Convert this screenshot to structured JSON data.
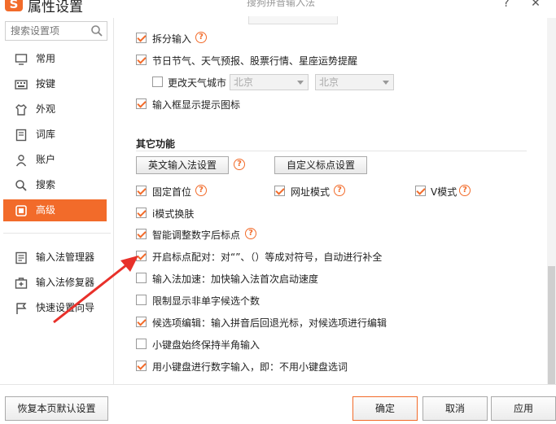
{
  "window": {
    "title": "属性设置",
    "subtitle": "搜狗拼音输入法",
    "help_glyph": "?",
    "close_glyph": "✕"
  },
  "sidebar": {
    "search_placeholder": "搜索设置项",
    "items": [
      {
        "label": "常用",
        "icon": "monitor-icon"
      },
      {
        "label": "按键",
        "icon": "keyboard-icon"
      },
      {
        "label": "外观",
        "icon": "shirt-icon"
      },
      {
        "label": "词库",
        "icon": "dictionary-icon"
      },
      {
        "label": "账户",
        "icon": "user-icon"
      },
      {
        "label": "搜索",
        "icon": "search-icon"
      },
      {
        "label": "高级",
        "icon": "advanced-icon",
        "active": true
      }
    ],
    "tools": [
      {
        "label": "输入法管理器",
        "icon": "manager-icon"
      },
      {
        "label": "输入法修复器",
        "icon": "repair-icon"
      },
      {
        "label": "快速设置向导",
        "icon": "wizard-flag-icon"
      }
    ]
  },
  "content": {
    "split_input": "拆分输入",
    "festival_info": "节日节气、天气预报、股票行情、星座运势提醒",
    "change_city": "更改天气城市",
    "city_select_1": "北京",
    "city_select_2": "北京",
    "show_tip_icon": "输入框显示提示图标",
    "other_section": "其它功能",
    "english_settings_btn": "英文输入法设置",
    "custom_punct_btn": "自定义标点设置",
    "fixed_first": "固定首位",
    "url_mode": "网址模式",
    "v_mode": "V模式",
    "i_mode": "i模式换肤",
    "smart_punct": "智能调整数字后标点",
    "auto_pair": "开启标点配对：对“”、（）等成对符号，自动进行补全",
    "speed_up": "输入法加速：加快输入法首次启动速度",
    "limit_non_single": "限制显示非单字候选个数",
    "candidate_edit": "候选项编辑：输入拼音后回退光标，对候选项进行编辑",
    "halfwidth_small_kb": "小键盘始终保持半角输入",
    "numpad_digits": "用小键盘进行数字输入，即：不用小键盘选词",
    "help_glyph": "?"
  },
  "checks": {
    "split_input": true,
    "festival_info": true,
    "change_city": false,
    "show_tip_icon": true,
    "fixed_first": true,
    "url_mode": true,
    "v_mode": true,
    "i_mode": true,
    "smart_punct": true,
    "auto_pair": true,
    "speed_up": false,
    "limit_non_single": false,
    "candidate_edit": true,
    "halfwidth_small_kb": false,
    "numpad_digits": true
  },
  "footer": {
    "restore_defaults": "恢复本页默认设置",
    "ok": "确定",
    "cancel": "取消",
    "apply": "应用"
  },
  "colors": {
    "accent": "#f26b2a",
    "annotation_arrow": "#e8302a"
  }
}
